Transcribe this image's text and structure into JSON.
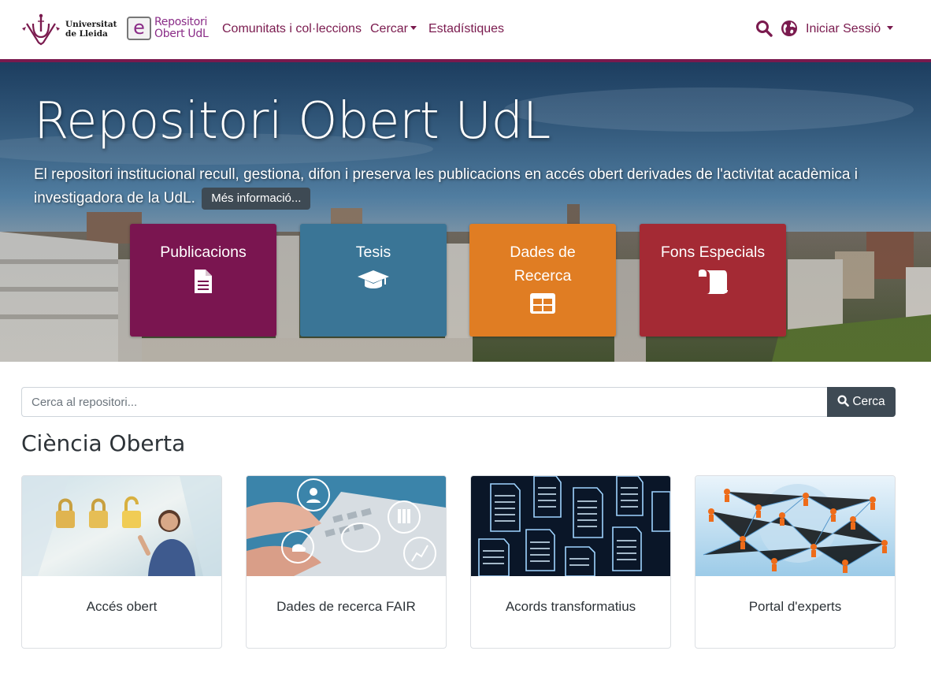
{
  "header": {
    "university_name": "Universitat\nde Lleida",
    "repo_logo_letter": "e",
    "repo_logo_text": "Repositori\nObert UdL",
    "nav": [
      {
        "label": "Comunitats i col·leccions"
      },
      {
        "label": "Cercar",
        "has_dropdown": true
      },
      {
        "label": "Estadístiques"
      }
    ],
    "search_icon": "search-icon",
    "language_icon": "globe-icon",
    "login_label": "Iniciar Sessió"
  },
  "hero": {
    "title": "Repositori Obert UdL",
    "description": "El repositori institucional recull, gestiona, difon i preserva les publicacions en accés obert derivades de l'activitat acadèmica i investigadora de la UdL.",
    "more_button": "Més informació..."
  },
  "tiles": [
    {
      "label": "Publicacions",
      "icon": "document-icon",
      "color": "#7a1550"
    },
    {
      "label": "Tesis",
      "icon": "graduation-cap-icon",
      "color": "#3a7596"
    },
    {
      "label": "Dades de\nRecerca",
      "icon": "table-icon",
      "color": "#e07d23"
    },
    {
      "label": "Fons Especials",
      "icon": "scroll-icon",
      "color": "#a42a34"
    }
  ],
  "search": {
    "placeholder": "Cerca al repositori...",
    "button_label": "Cerca"
  },
  "section": {
    "title": "Ciència Oberta"
  },
  "cards": [
    {
      "label": "Accés obert"
    },
    {
      "label": "Dades de recerca FAIR"
    },
    {
      "label": "Acords transformatius"
    },
    {
      "label": "Portal d'experts"
    }
  ],
  "colors": {
    "brand": "#7a1a4e",
    "button_dark": "#3e4a54"
  }
}
